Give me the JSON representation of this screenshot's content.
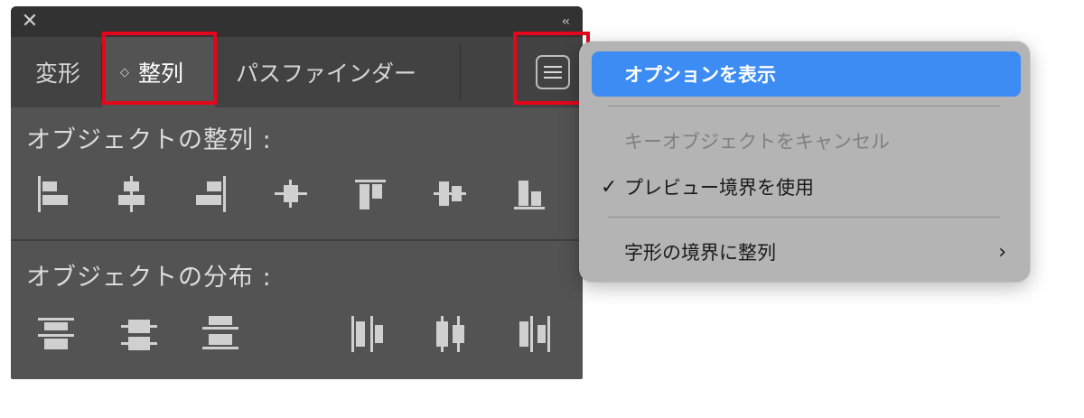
{
  "panel": {
    "close_glyph": "✕",
    "collapse_glyph": "‹‹",
    "tabs": [
      {
        "label": "変形"
      },
      {
        "label": "整列",
        "active": true
      },
      {
        "label": "パスファインダー"
      }
    ],
    "active_tab_marker": "◇",
    "sections": {
      "align_title": "オブジェクトの整列 :",
      "distribute_title": "オブジェクトの分布 :"
    },
    "align_icons": [
      "align-left-edges-icon",
      "align-horizontal-centers-icon",
      "align-right-edges-icon",
      "align-vertical-centers-icon",
      "align-top-edges-icon",
      "align-middle-icon",
      "align-bottom-edges-icon"
    ],
    "distribute_icons": [
      "distribute-top-icon",
      "distribute-vertical-centers-icon",
      "distribute-bottom-icon",
      "distribute-left-icon",
      "distribute-horizontal-centers-icon",
      "distribute-right-icon"
    ],
    "menu_button_icon": "hamburger-menu-icon",
    "highlight_color": "#e6061b",
    "background_color": "#535353"
  },
  "menu": {
    "items": [
      {
        "label": "オプションを表示",
        "selected": true
      },
      {
        "label": "キーオブジェクトをキャンセル",
        "disabled": true
      },
      {
        "label": "プレビュー境界を使用",
        "checked": true,
        "check_glyph": "✓"
      },
      {
        "label": "字形の境界に整列",
        "submenu": true,
        "arrow_glyph": "›"
      }
    ],
    "selected_color": "#3c8cf4",
    "background_color": "#b4b4b4"
  }
}
